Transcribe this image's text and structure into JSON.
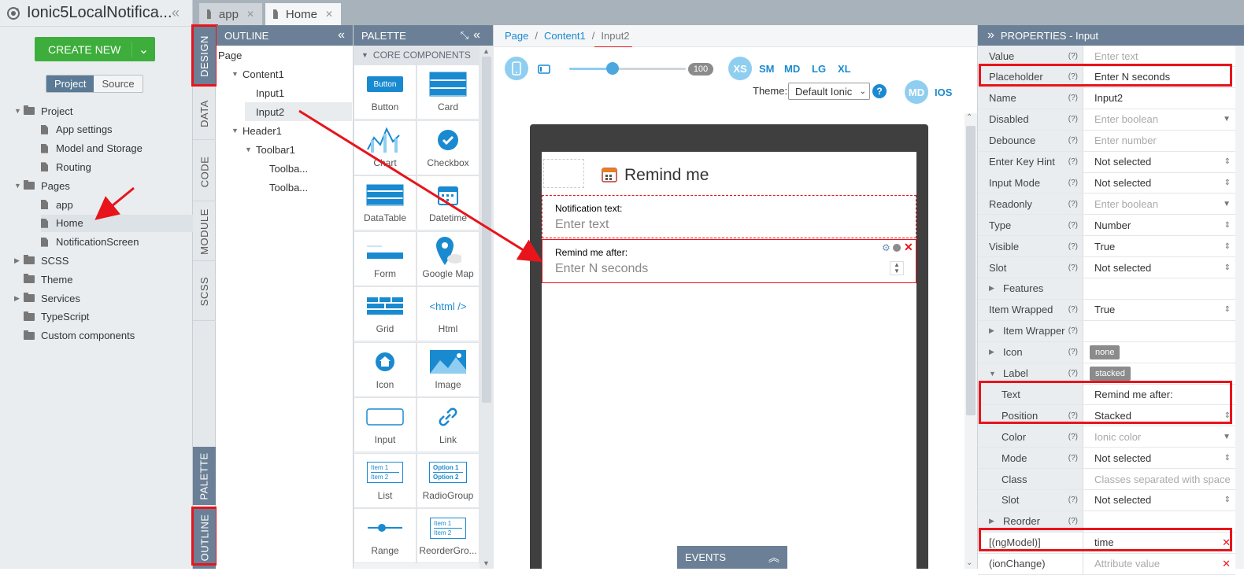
{
  "project": {
    "name": "Ionic5LocalNotifica...",
    "create_label": "CREATE NEW",
    "seg_project": "Project",
    "seg_source": "Source"
  },
  "tree": [
    {
      "label": "Project",
      "kind": "folder",
      "level": 0,
      "tri": "▼"
    },
    {
      "label": "App settings",
      "kind": "file",
      "level": 1
    },
    {
      "label": "Model and Storage",
      "kind": "file",
      "level": 1
    },
    {
      "label": "Routing",
      "kind": "file",
      "level": 1
    },
    {
      "label": "Pages",
      "kind": "folder",
      "level": 0,
      "tri": "▼"
    },
    {
      "label": "app",
      "kind": "file",
      "level": 1
    },
    {
      "label": "Home",
      "kind": "file",
      "level": 1,
      "selected": true
    },
    {
      "label": "NotificationScreen",
      "kind": "file",
      "level": 1
    },
    {
      "label": "SCSS",
      "kind": "folder",
      "level": 0,
      "tri": "▶"
    },
    {
      "label": "Theme",
      "kind": "folder",
      "level": 0,
      "tri": ""
    },
    {
      "label": "Services",
      "kind": "folder",
      "level": 0,
      "tri": "▶"
    },
    {
      "label": "TypeScript",
      "kind": "folder",
      "level": 0,
      "tri": ""
    },
    {
      "label": "Custom components",
      "kind": "folder",
      "level": 0,
      "tri": ""
    }
  ],
  "vtabs": {
    "design": "DESIGN",
    "data": "DATA",
    "code": "CODE",
    "module": "MODULE",
    "scss": "SCSS",
    "palette": "PALETTE",
    "outline": "OUTLINE"
  },
  "tabs": [
    {
      "label": "app"
    },
    {
      "label": "Home"
    }
  ],
  "outline": {
    "title": "OUTLINE",
    "items": [
      {
        "label": "Page",
        "level": 0,
        "tri": ""
      },
      {
        "label": "Content1",
        "level": 1,
        "tri": "▼"
      },
      {
        "label": "Input1",
        "level": 2,
        "tri": ""
      },
      {
        "label": "Input2",
        "level": 2,
        "tri": "",
        "selected": true
      },
      {
        "label": "Header1",
        "level": 1,
        "tri": "▼"
      },
      {
        "label": "Toolbar1",
        "level": 2,
        "tri": "▼"
      },
      {
        "label": "Toolba...",
        "level": 3,
        "tri": ""
      },
      {
        "label": "Toolba...",
        "level": 3,
        "tri": ""
      }
    ]
  },
  "palette": {
    "title": "PALETTE",
    "section": "CORE COMPONENTS",
    "items": [
      "Button",
      "Card",
      "Chart",
      "Checkbox",
      "DataTable",
      "Datetime",
      "Form",
      "Google Map",
      "Grid",
      "Html",
      "Icon",
      "Image",
      "Input",
      "Link",
      "List",
      "RadioGroup",
      "Range",
      "ReorderGro..."
    ],
    "button_icon_text": "Button",
    "html_icon_text": "<html />",
    "list_icon_text": [
      "Item 1",
      "Item 2"
    ],
    "radio_icon_text": [
      "Option 1",
      "Option 2"
    ],
    "reorder_icon_text": [
      "Item 1",
      "Item 2"
    ]
  },
  "breadcrumb": {
    "page": "Page",
    "content": "Content1",
    "current": "Input2",
    "sep": "/"
  },
  "toolbar": {
    "zoom": "100",
    "sizes": [
      "XS",
      "SM",
      "MD",
      "LG",
      "XL"
    ],
    "theme_label": "Theme:",
    "theme_value": "Default Ionic",
    "help": "?",
    "md": "MD",
    "ios": "IOS"
  },
  "screen": {
    "header_title": "Remind me",
    "input1_label": "Notification text:",
    "input1_placeholder": "Enter text",
    "input2_label": "Remind me after:",
    "input2_placeholder": "Enter N seconds"
  },
  "events_label": "EVENTS",
  "properties": {
    "title": "PROPERTIES - Input",
    "rows": [
      {
        "name": "Value",
        "q": true,
        "value": "Enter text",
        "ph": true
      },
      {
        "name": "Placeholder",
        "q": true,
        "value": "Enter N seconds"
      },
      {
        "name": "Name",
        "q": true,
        "value": "Input2"
      },
      {
        "name": "Disabled",
        "q": true,
        "value": "Enter boolean",
        "ph": true,
        "arrow": "▼"
      },
      {
        "name": "Debounce",
        "q": true,
        "value": "Enter number",
        "ph": true
      },
      {
        "name": "Enter Key Hint",
        "q": true,
        "value": "Not selected",
        "arrow": "⇕"
      },
      {
        "name": "Input Mode",
        "q": true,
        "value": "Not selected",
        "arrow": "⇕"
      },
      {
        "name": "Readonly",
        "q": true,
        "value": "Enter boolean",
        "ph": true,
        "arrow": "▼"
      },
      {
        "name": "Type",
        "q": true,
        "value": "Number",
        "arrow": "⇕"
      },
      {
        "name": "Visible",
        "q": true,
        "value": "True",
        "arrow": "⇕"
      },
      {
        "name": "Slot",
        "q": true,
        "value": "Not selected",
        "arrow": "⇕"
      },
      {
        "name": "Features",
        "q": false,
        "value": "",
        "tri": "▶"
      },
      {
        "name": "Item Wrapped",
        "q": true,
        "value": "True",
        "arrow": "⇕"
      },
      {
        "name": "Item Wrapper",
        "q": true,
        "value": "",
        "tri": "▶"
      },
      {
        "name": "Icon",
        "q": true,
        "value": "none",
        "badge": true,
        "tri": "▶"
      },
      {
        "name": "Label",
        "q": true,
        "value": "stacked",
        "badge": true,
        "tri": "▼"
      },
      {
        "name": "Text",
        "q": false,
        "value": "Remind me after:",
        "sub": true
      },
      {
        "name": "Position",
        "q": true,
        "value": "Stacked",
        "sub": true,
        "arrow": "⇕"
      },
      {
        "name": "Color",
        "q": true,
        "value": "Ionic color",
        "ph": true,
        "sub": true,
        "arrow": "▼"
      },
      {
        "name": "Mode",
        "q": true,
        "value": "Not selected",
        "sub": true,
        "arrow": "⇕"
      },
      {
        "name": "Class",
        "q": false,
        "value": "Classes separated with space",
        "ph": true,
        "sub": true
      },
      {
        "name": "Slot",
        "q": true,
        "value": "Not selected",
        "sub": true,
        "arrow": "⇕"
      },
      {
        "name": "Reorder",
        "q": true,
        "value": "",
        "tri": "▶"
      },
      {
        "name": "[(ngModel)]",
        "q": false,
        "value": "time",
        "remove": true
      },
      {
        "name": "(ionChange)",
        "q": false,
        "value": "Attribute value",
        "ph": true,
        "remove": true
      }
    ]
  },
  "colors": {
    "accent": "#1a8ad0",
    "header": "#6b8096",
    "green": "#3dae3b",
    "highlight": "#e8141b"
  }
}
